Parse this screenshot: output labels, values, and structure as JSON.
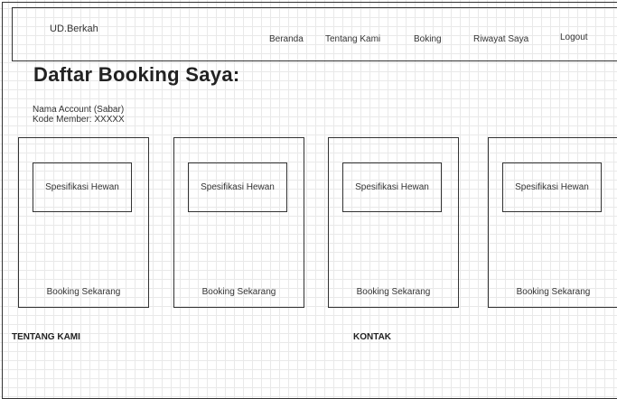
{
  "navbar": {
    "brand": "UD.Berkah",
    "links": [
      {
        "label": "Beranda"
      },
      {
        "label": "Tentang Kami"
      },
      {
        "label": "Boking"
      },
      {
        "label": "Riwayat Saya"
      },
      {
        "label": "Logout"
      }
    ]
  },
  "page": {
    "title": "Daftar Booking Saya:",
    "account_name": "Nama Account (Sabar)",
    "member_code": "Kode Member: XXXXX"
  },
  "cards": [
    {
      "spec_label": "Spesifikasi Hewan",
      "button_label": "Booking Sekarang"
    },
    {
      "spec_label": "Spesifikasi Hewan",
      "button_label": "Booking Sekarang"
    },
    {
      "spec_label": "Spesifikasi Hewan",
      "button_label": "Booking Sekarang"
    },
    {
      "spec_label": "Spesifikasi Hewan",
      "button_label": "Booking Sekarang"
    }
  ],
  "footer": {
    "about_heading": "TENTANG KAMI",
    "contact_heading": "KONTAK"
  }
}
